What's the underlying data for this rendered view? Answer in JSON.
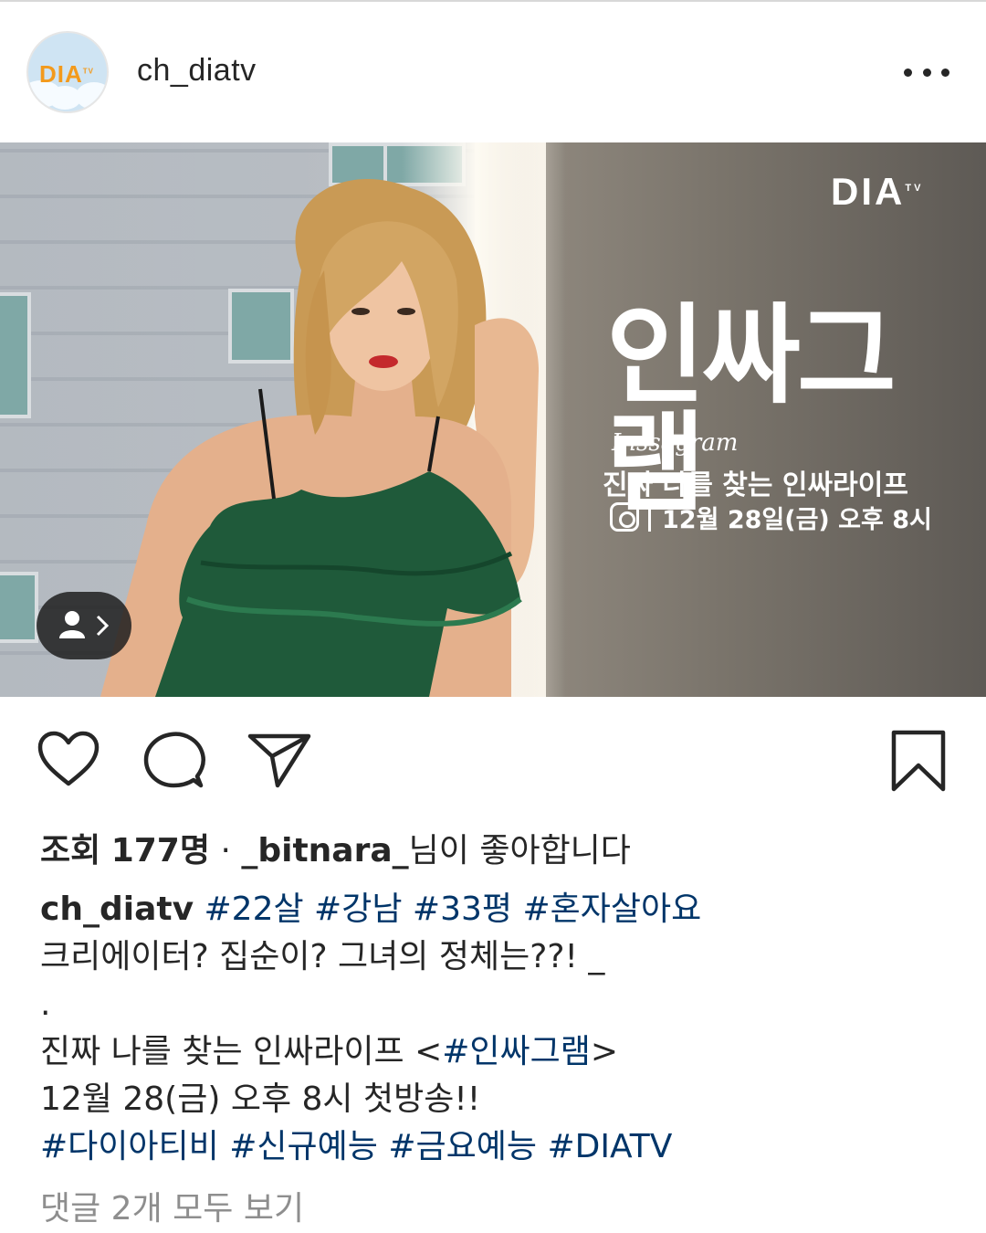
{
  "post": {
    "username": "ch_diatv",
    "avatar_logo": "DIA",
    "avatar_logo_tv": "TV",
    "more_icon": "more-horizontal-icon"
  },
  "media": {
    "brand_logo": "DIA",
    "brand_logo_tv": "TV",
    "show_title": "인싸그램",
    "show_subtitle": "Inssagram",
    "tagline": "진짜 나를 찾는 인싸라이프",
    "airtime": "12월 28일(금) 오후 8시",
    "tagged_people_icon": "person-icon"
  },
  "actions": {
    "like_icon": "heart-icon",
    "comment_icon": "comment-icon",
    "share_icon": "send-icon",
    "save_icon": "bookmark-icon"
  },
  "stats": {
    "views_label": "조회",
    "views_count": "177명",
    "separator": "·",
    "liked_by": "_bitnara_",
    "liked_suffix": "님이 좋아합니다"
  },
  "caption": {
    "username": "ch_diatv",
    "hashtags_line1": [
      "#22살",
      "#강남",
      "#33평",
      "#혼자살아요"
    ],
    "line2": "크리에이터? 집순이? 그녀의 정체는??! _",
    "line3": ".",
    "line4_prefix": "진짜 나를 찾는 인싸라이프 <",
    "line4_tag": "#인싸그램",
    "line4_suffix": ">",
    "line5": "12월 28(금) 오후 8시 첫방송!!",
    "hashtags_line6": [
      "#다이아티비",
      "#신규예능",
      "#금요예능",
      "#DIATV"
    ]
  },
  "comments": {
    "view_all": "댓글 2개 모두 보기"
  },
  "colors": {
    "text": "#262626",
    "hashtag": "#003569",
    "muted": "#8e8e8e",
    "avatar_brand": "#f39a1c"
  }
}
